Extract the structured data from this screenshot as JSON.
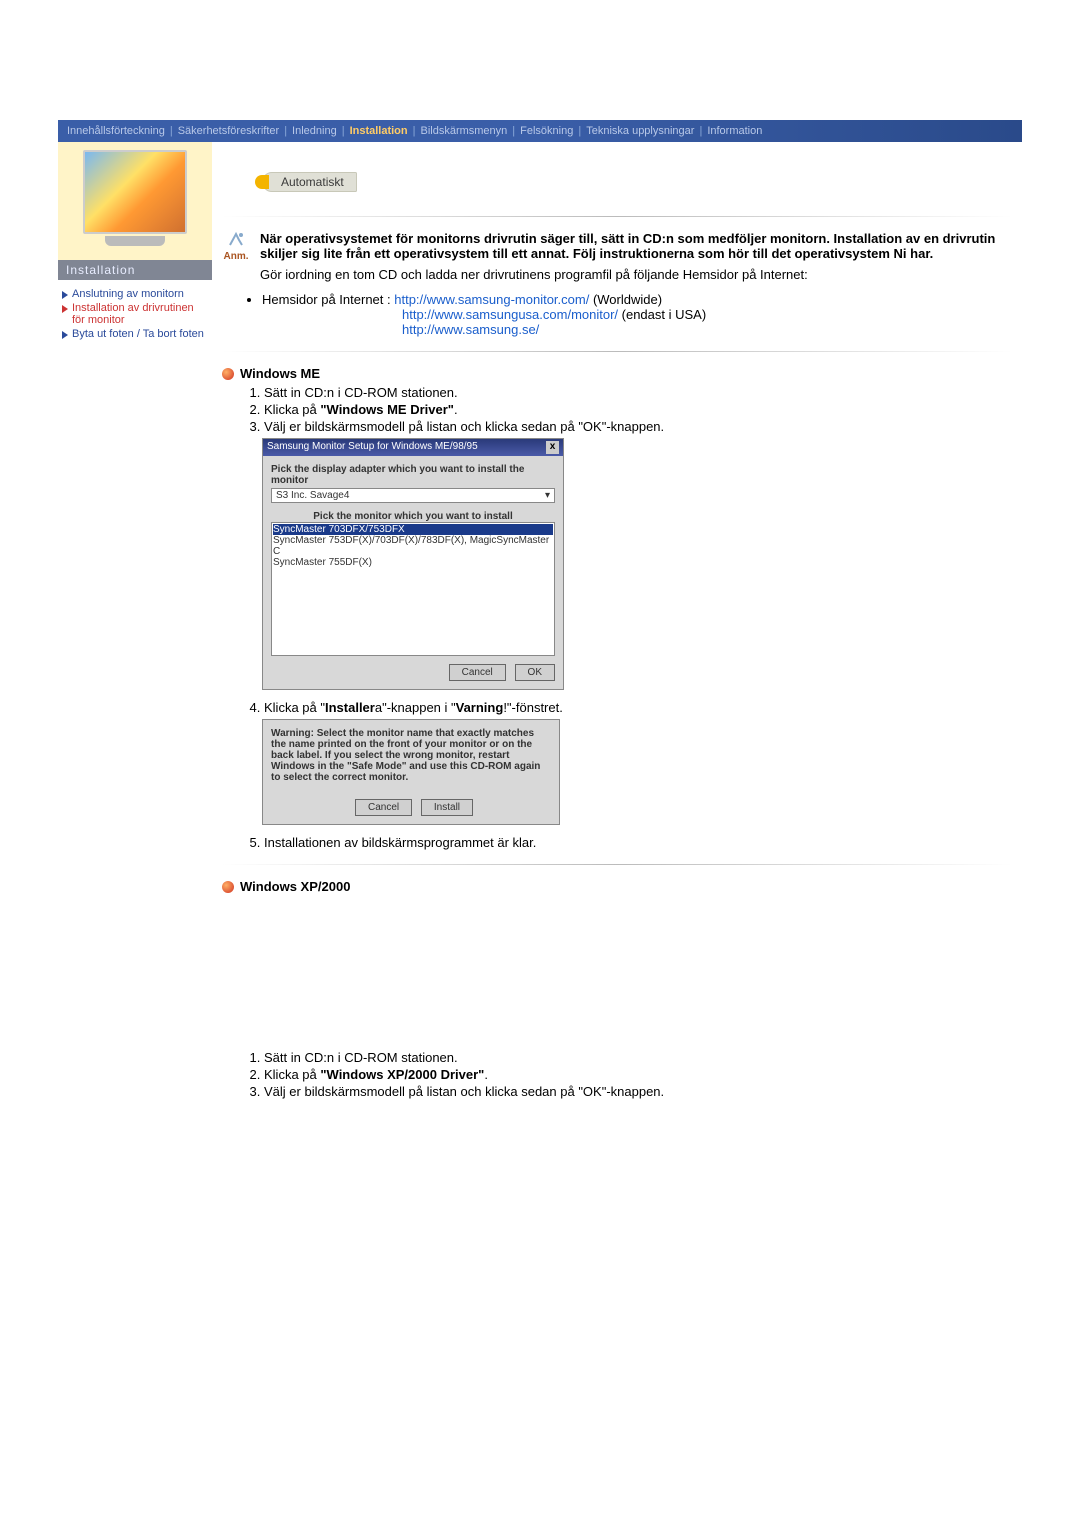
{
  "nav": {
    "items": [
      "Innehållsförteckning",
      "Säkerhetsföreskrifter",
      "Inledning",
      "Installation",
      "Bildskärmsmenyn",
      "Felsökning",
      "Tekniska upplysningar",
      "Information"
    ],
    "active_index": 3
  },
  "sidebar": {
    "title": "Installation",
    "links": [
      {
        "text": "Anslutning av monitorn",
        "active": false
      },
      {
        "text": "Installation av drivrutinen för monitor",
        "active": true
      },
      {
        "text": "Byta ut foten / Ta bort foten",
        "active": false
      }
    ]
  },
  "tab_label": "Automatiskt",
  "anm_label": "Anm.",
  "intro_bold": "När operativsystemet för monitorns drivrutin säger till, sätt in CD:n som medföljer monitorn. Installation av en drivrutin skiljer sig lite från ett operativsystem till ett annat. Följ instruktionerna som hör till det operativsystem Ni har.",
  "intro_plain": "Gör iordning en tom CD och ladda ner drivrutinens programfil på följande Hemsidor på Internet:",
  "homesites": {
    "label": "Hemsidor på Internet :",
    "rows": [
      {
        "url": "http://www.samsung-monitor.com/",
        "suffix": " (Worldwide)"
      },
      {
        "url": "http://www.samsungusa.com/monitor/",
        "suffix": " (endast i USA)"
      },
      {
        "url": "http://www.samsung.se/",
        "suffix": ""
      }
    ]
  },
  "me": {
    "heading": "Windows ME",
    "step1": "Sätt in CD:n i CD-ROM stationen.",
    "step2_pre": "Klicka på ",
    "step2_bold": "\"Windows ME Driver\"",
    "step2_post": ".",
    "step3": "Välj er bildskärmsmodell på listan och klicka sedan på \"OK\"-knappen.",
    "step4_pre": "Klicka på \"",
    "step4_b1": "Installer",
    "step4_mid": "a\"-knappen i \"",
    "step4_b2": "Varning",
    "step4_post": "!\"-fönstret.",
    "step5": "Installationen av bildskärmsprogrammet är klar."
  },
  "dlg1": {
    "title": "Samsung Monitor Setup for Windows ME/98/95",
    "line1": "Pick the display adapter which you want to install the monitor",
    "adapter": "S3 Inc. Savage4",
    "line2": "Pick the monitor which you want to install",
    "items": [
      "SyncMaster 703DFX/753DFX",
      "SyncMaster 753DF(X)/703DF(X)/783DF(X), MagicSyncMaster C",
      "SyncMaster 755DF(X)"
    ],
    "btn_cancel": "Cancel",
    "btn_ok": "OK"
  },
  "dlg2": {
    "warning": "Warning: Select the monitor name that exactly matches the name printed on the front of your monitor or on the back label. If you select the wrong monitor, restart Windows in the \"Safe Mode\" and use this CD-ROM again to select the correct monitor.",
    "btn_cancel": "Cancel",
    "btn_install": "Install"
  },
  "xp": {
    "heading": "Windows XP/2000",
    "step1": "Sätt in CD:n i CD-ROM stationen.",
    "step2_pre": "Klicka på ",
    "step2_bold": "\"Windows XP/2000 Driver\"",
    "step2_post": ".",
    "step3": "Välj er bildskärmsmodell på listan och klicka sedan på \"OK\"-knappen."
  }
}
